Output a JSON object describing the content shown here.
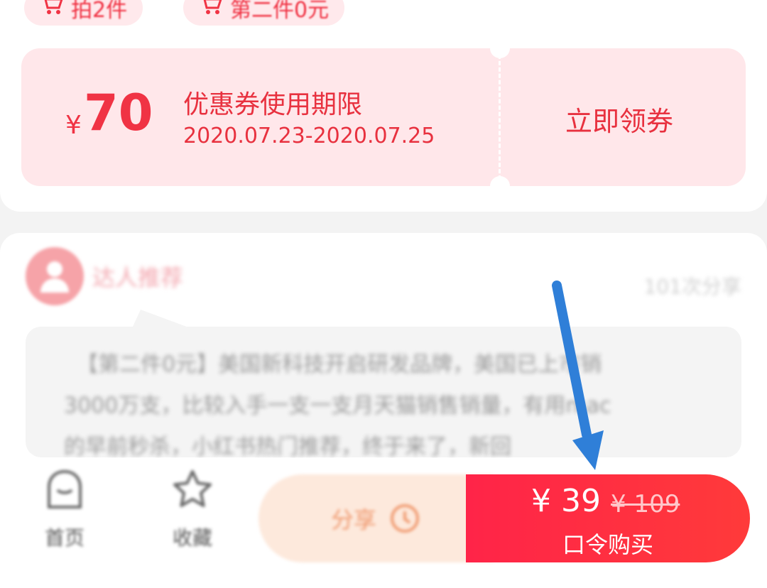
{
  "tags": [
    {
      "label": "拍2件"
    },
    {
      "label": "第二件0元"
    }
  ],
  "coupon": {
    "currency": "¥",
    "amount": "70",
    "label": "优惠券使用期限",
    "dates": "2020.07.23-2020.07.25",
    "claim_label": "立即领券"
  },
  "post": {
    "author": "达人推荐",
    "meta": "101次分享",
    "lines": [
      "【第二件0元】美国新科技开启研发品牌，美国已上市销",
      "3000万支，比较入手一支一支月天猫销售销量，有用mac",
      "的早前秒杀，小红书热门推荐，终于来了，新回"
    ]
  },
  "bottom_bar": {
    "home_label": "首页",
    "fav_label": "收藏",
    "share_label": "分享",
    "price": "¥ 39",
    "original_price": "¥ 109",
    "buy_label": "口令购买"
  },
  "colors": {
    "accent": "#f03344",
    "coupon_bg": "#ffe7ea",
    "buy_gradient_start": "#ff2448",
    "buy_gradient_end": "#ff3a3a",
    "annotation_arrow": "#2f7fd8"
  }
}
